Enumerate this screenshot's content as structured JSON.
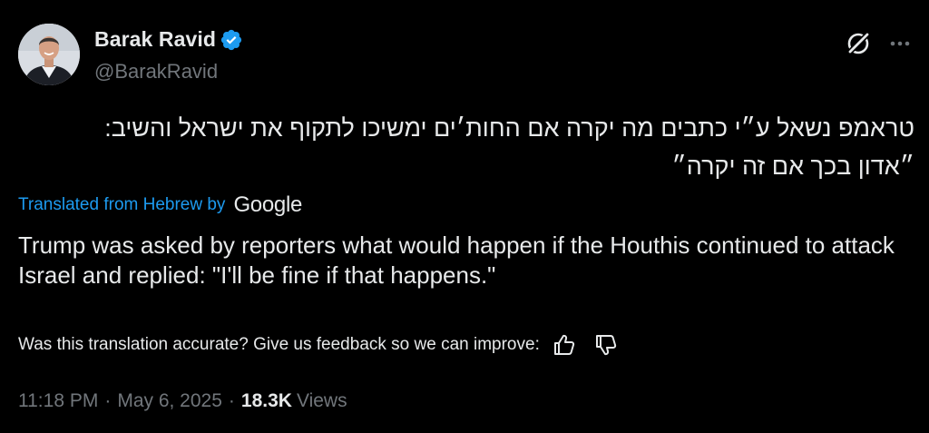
{
  "author": {
    "display_name": "Barak Ravid",
    "handle": "@BarakRavid",
    "verified": true
  },
  "tweet": {
    "original_lines": [
      "טראמפ נשאל ע״י כתבים מה יקרה אם החות׳ים ימשיכו לתקוף את ישראל והשיב:",
      "״אדון בכך אם זה יקרה״"
    ],
    "translated_from_label": "Translated from Hebrew by",
    "translator": "Google",
    "translation": "Trump was asked by reporters what would happen if the Houthis continued to attack Israel and replied: \"I'll be fine if that happens.\"",
    "feedback_prompt": "Was this translation accurate? Give us feedback so we can improve:"
  },
  "meta": {
    "time": "11:18 PM",
    "separator": "·",
    "date": "May 6, 2025",
    "views_count": "18.3K",
    "views_label": "Views"
  },
  "icons": {
    "verified": "verified-badge-icon",
    "grok": "grok-icon",
    "more": "more-options-icon",
    "thumbs_up": "thumbs-up-icon",
    "thumbs_down": "thumbs-down-icon"
  },
  "colors": {
    "background": "#000000",
    "text_primary": "#e7e9ea",
    "text_secondary": "#71767b",
    "accent": "#1d9bf0"
  }
}
